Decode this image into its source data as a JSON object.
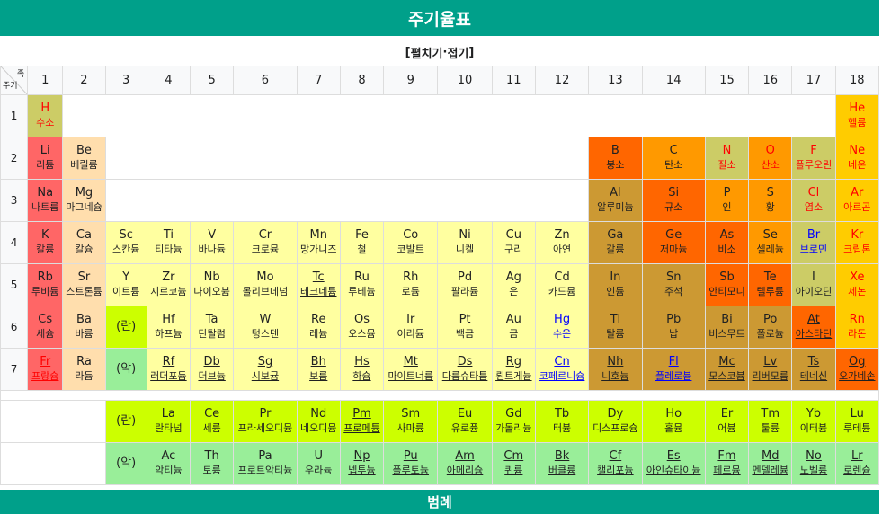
{
  "title": "주기율표",
  "toggle": {
    "open_bracket": "[ ",
    "expand": "펼치기",
    "sep": " · ",
    "collapse": "접기",
    "close_bracket": " ]"
  },
  "corner": {
    "group": "족",
    "period": "주기"
  },
  "groups": [
    "1",
    "2",
    "3",
    "4",
    "5",
    "6",
    "7",
    "8",
    "9",
    "10",
    "11",
    "12",
    "13",
    "14",
    "15",
    "16",
    "17",
    "18"
  ],
  "periods": [
    "1",
    "2",
    "3",
    "4",
    "5",
    "6",
    "7"
  ],
  "lan_label": "(란)",
  "act_label": "(악)",
  "legend": "범례",
  "colors": {
    "header": "#00a08a",
    "alkali": "#ff6666",
    "alkaline_earth": "#ffdead",
    "transition": "#ffffa0",
    "post_transition": "#cc9933",
    "metalloid": "#cccc66",
    "nonmetal": "#ff9900",
    "noble_gas": "#ffcc00",
    "lanthanide": "#ccff00",
    "actinide": "#99ee99"
  },
  "rows": [
    [
      [
        "H",
        "수소"
      ],
      [
        "He",
        "헬륨"
      ]
    ],
    [
      [
        "Li",
        "리튬"
      ],
      [
        "Be",
        "베릴륨"
      ],
      [
        "B",
        "붕소"
      ],
      [
        "C",
        "탄소"
      ],
      [
        "N",
        "질소"
      ],
      [
        "O",
        "산소"
      ],
      [
        "F",
        "플루오린"
      ],
      [
        "Ne",
        "네온"
      ]
    ],
    [
      [
        "Na",
        "나트륨"
      ],
      [
        "Mg",
        "마그네슘"
      ],
      [
        "Al",
        "알루미늄"
      ],
      [
        "Si",
        "규소"
      ],
      [
        "P",
        "인"
      ],
      [
        "S",
        "황"
      ],
      [
        "Cl",
        "염소"
      ],
      [
        "Ar",
        "아르곤"
      ]
    ],
    [
      [
        "K",
        "칼륨"
      ],
      [
        "Ca",
        "칼슘"
      ],
      [
        "Sc",
        "스칸듐"
      ],
      [
        "Ti",
        "티타늄"
      ],
      [
        "V",
        "바나듐"
      ],
      [
        "Cr",
        "크로뮴"
      ],
      [
        "Mn",
        "망가니즈"
      ],
      [
        "Fe",
        "철"
      ],
      [
        "Co",
        "코발트"
      ],
      [
        "Ni",
        "니켈"
      ],
      [
        "Cu",
        "구리"
      ],
      [
        "Zn",
        "아연"
      ],
      [
        "Ga",
        "갈륨"
      ],
      [
        "Ge",
        "저마늄"
      ],
      [
        "As",
        "비소"
      ],
      [
        "Se",
        "셀레늄"
      ],
      [
        "Br",
        "브로민"
      ],
      [
        "Kr",
        "크립톤"
      ]
    ],
    [
      [
        "Rb",
        "루비듐"
      ],
      [
        "Sr",
        "스트론튬"
      ],
      [
        "Y",
        "이트륨"
      ],
      [
        "Zr",
        "지르코늄"
      ],
      [
        "Nb",
        "나이오븀"
      ],
      [
        "Mo",
        "몰리브데넘"
      ],
      [
        "Tc",
        "테크네튬"
      ],
      [
        "Ru",
        "루테늄"
      ],
      [
        "Rh",
        "로듐"
      ],
      [
        "Pd",
        "팔라듐"
      ],
      [
        "Ag",
        "은"
      ],
      [
        "Cd",
        "카드뮴"
      ],
      [
        "In",
        "인듐"
      ],
      [
        "Sn",
        "주석"
      ],
      [
        "Sb",
        "안티모니"
      ],
      [
        "Te",
        "텔루륨"
      ],
      [
        "I",
        "아이오딘"
      ],
      [
        "Xe",
        "제논"
      ]
    ],
    [
      [
        "Cs",
        "세슘"
      ],
      [
        "Ba",
        "바륨"
      ],
      [
        "Hf",
        "하프늄"
      ],
      [
        "Ta",
        "탄탈럼"
      ],
      [
        "W",
        "텅스텐"
      ],
      [
        "Re",
        "레늄"
      ],
      [
        "Os",
        "오스뮴"
      ],
      [
        "Ir",
        "이리듐"
      ],
      [
        "Pt",
        "백금"
      ],
      [
        "Au",
        "금"
      ],
      [
        "Hg",
        "수은"
      ],
      [
        "Tl",
        "탈륨"
      ],
      [
        "Pb",
        "납"
      ],
      [
        "Bi",
        "비스무트"
      ],
      [
        "Po",
        "폴로늄"
      ],
      [
        "At",
        "아스타틴"
      ],
      [
        "Rn",
        "라돈"
      ]
    ],
    [
      [
        "Fr",
        "프랑슘"
      ],
      [
        "Ra",
        "라듐"
      ],
      [
        "Rf",
        "러더포듐"
      ],
      [
        "Db",
        "더브늄"
      ],
      [
        "Sg",
        "시보귬"
      ],
      [
        "Bh",
        "보륨"
      ],
      [
        "Hs",
        "하슘"
      ],
      [
        "Mt",
        "마이트너륨"
      ],
      [
        "Ds",
        "다름슈타튬"
      ],
      [
        "Rg",
        "뢴트게늄"
      ],
      [
        "Cn",
        "코페르니슘"
      ],
      [
        "Nh",
        "니호늄"
      ],
      [
        "Fl",
        "플레로븀"
      ],
      [
        "Mc",
        "모스코븀"
      ],
      [
        "Lv",
        "리버모륨"
      ],
      [
        "Ts",
        "테네신"
      ],
      [
        "Og",
        "오가네손"
      ]
    ]
  ],
  "lanthanides": [
    [
      "La",
      "란타넘"
    ],
    [
      "Ce",
      "세륨"
    ],
    [
      "Pr",
      "프라세오디뮴"
    ],
    [
      "Nd",
      "네오디뮴"
    ],
    [
      "Pm",
      "프로메튬"
    ],
    [
      "Sm",
      "사마륨"
    ],
    [
      "Eu",
      "유로퓸"
    ],
    [
      "Gd",
      "가돌리늄"
    ],
    [
      "Tb",
      "터븀"
    ],
    [
      "Dy",
      "디스프로슘"
    ],
    [
      "Ho",
      "홀뮴"
    ],
    [
      "Er",
      "어븀"
    ],
    [
      "Tm",
      "툴륨"
    ],
    [
      "Yb",
      "이터븀"
    ],
    [
      "Lu",
      "루테튬"
    ]
  ],
  "actinides": [
    [
      "Ac",
      "악티늄"
    ],
    [
      "Th",
      "토륨"
    ],
    [
      "Pa",
      "프로트악티늄"
    ],
    [
      "U",
      "우라늄"
    ],
    [
      "Np",
      "넵투늄"
    ],
    [
      "Pu",
      "플루토늄"
    ],
    [
      "Am",
      "아메리슘"
    ],
    [
      "Cm",
      "퀴륨"
    ],
    [
      "Bk",
      "버클륨"
    ],
    [
      "Cf",
      "캘리포늄"
    ],
    [
      "Es",
      "아인슈타이늄"
    ],
    [
      "Fm",
      "페르뮴"
    ],
    [
      "Md",
      "멘델레븀"
    ],
    [
      "No",
      "노벨륨"
    ],
    [
      "Lr",
      "로렌슘"
    ]
  ]
}
